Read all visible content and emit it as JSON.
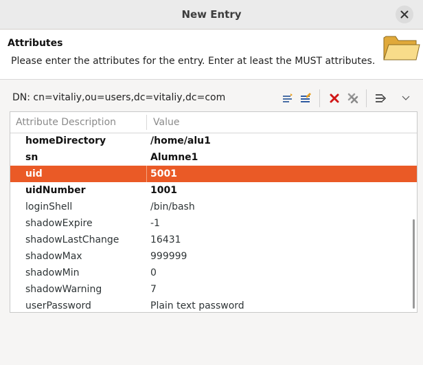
{
  "window": {
    "title": "New Entry"
  },
  "banner": {
    "heading": "Attributes",
    "description": "Please enter the attributes for the entry. Enter at least the MUST attributes."
  },
  "dn": {
    "label": "DN: cn=vitaliy,ou=users,dc=vitaliy,dc=com"
  },
  "toolbar": {
    "icons": [
      "new-value-icon",
      "edit-value-icon",
      "delete-icon",
      "delete-all-icon",
      "expand-icon",
      "menu-chevron-icon"
    ]
  },
  "table": {
    "headers": {
      "name": "Attribute Description",
      "value": "Value"
    },
    "rows": [
      {
        "name": "homeDirectory",
        "value": "/home/alu1",
        "must": true
      },
      {
        "name": "sn",
        "value": "Alumne1",
        "must": true
      },
      {
        "name": "uid",
        "value": "5001",
        "must": true,
        "selected": true
      },
      {
        "name": "uidNumber",
        "value": "1001",
        "must": true
      },
      {
        "name": "loginShell",
        "value": "/bin/bash",
        "must": false
      },
      {
        "name": "shadowExpire",
        "value": "-1",
        "must": false
      },
      {
        "name": "shadowLastChange",
        "value": "16431",
        "must": false
      },
      {
        "name": "shadowMax",
        "value": "999999",
        "must": false
      },
      {
        "name": "shadowMin",
        "value": "0",
        "must": false
      },
      {
        "name": "shadowWarning",
        "value": "7",
        "must": false
      },
      {
        "name": "userPassword",
        "value": "Plain text password",
        "must": false
      }
    ]
  },
  "colors": {
    "selection": "#ea5a26",
    "delete": "#d01616"
  }
}
